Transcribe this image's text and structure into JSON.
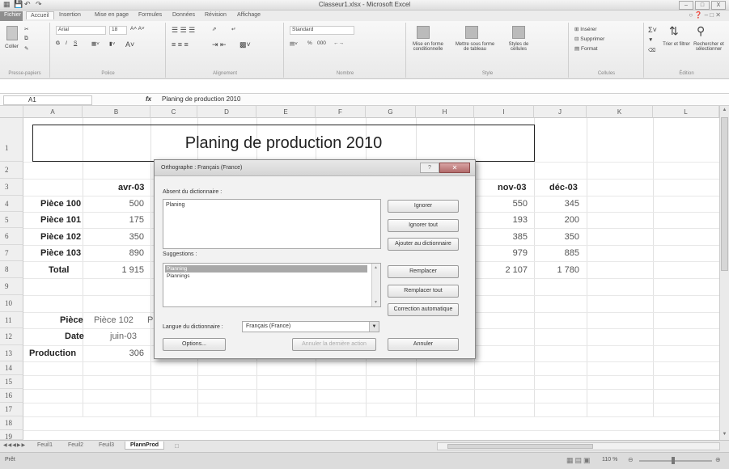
{
  "app": {
    "window_title": "Classeur1.xlsx - Microsoft Excel"
  },
  "window_controls": [
    "–",
    "□",
    "X"
  ],
  "ribbon_tabs": [
    "Fichier",
    "Accueil",
    "Insertion",
    "Mise en page",
    "Formules",
    "Données",
    "Révision",
    "Affichage"
  ],
  "ribbon": {
    "clipboard": {
      "label": "Presse-papiers",
      "paste": "Coller"
    },
    "font": {
      "label": "Police",
      "font_name": "Arial",
      "font_size": "18",
      "bold": "G",
      "italic": "I",
      "underline": "S"
    },
    "alignment": {
      "label": "Alignement"
    },
    "number": {
      "label": "Nombre",
      "format": "Standard",
      "percent": "%",
      "thousands": "000"
    },
    "styles": {
      "label": "Style",
      "cond": "Mise en forme conditionnelle",
      "table": "Mettre sous forme de tableau",
      "cell": "Styles de cellules"
    },
    "cells": {
      "label": "Cellules",
      "insert": "Insérer",
      "delete": "Supprimer",
      "format": "Format"
    },
    "editing": {
      "label": "Édition",
      "sort": "Trier et filtrer",
      "find": "Rechercher et sélectionner"
    }
  },
  "formula_bar": {
    "name_box": "A1",
    "fx": "fx",
    "content": "Planing de production 2010"
  },
  "columns": [
    "A",
    "B",
    "C",
    "D",
    "E",
    "F",
    "G",
    "H",
    "I",
    "J",
    "K",
    "L"
  ],
  "rows": [
    "1",
    "2",
    "3",
    "4",
    "5",
    "6",
    "7",
    "8",
    "9",
    "10",
    "11",
    "12",
    "13",
    "14",
    "15",
    "16",
    "17",
    "18",
    "19"
  ],
  "sheet": {
    "title": "Planing de production 2010",
    "header_b": "avr-03",
    "header_i": "nov-03",
    "header_j": "déc-03",
    "items": [
      {
        "label": "Pièce 100",
        "b": "500",
        "i": "550",
        "j": "345"
      },
      {
        "label": "Pièce 101",
        "b": "175",
        "i": "193",
        "j": "200"
      },
      {
        "label": "Pièce 102",
        "b": "350",
        "i": "385",
        "j": "350"
      },
      {
        "label": "Pièce 103",
        "b": "890",
        "i": "979",
        "j": "885"
      }
    ],
    "total": {
      "label": "Total",
      "b": "1 915",
      "i": "2 107",
      "j": "1 780"
    },
    "lookup": {
      "piece_label": "Pièce",
      "piece_value": "Pièce 102",
      "piece_extra": "P",
      "date_label": "Date",
      "date_value": "juin-03",
      "prod_label": "Production",
      "prod_value": "306"
    }
  },
  "dialog": {
    "title": "Orthographe : Français (France)",
    "absent_label": "Absent du dictionnaire :",
    "absent_word": "Planing",
    "suggestions_label": "Suggestions :",
    "suggestions": [
      "Planning",
      "Plannings"
    ],
    "language_label": "Langue du dictionnaire :",
    "language_value": "Français (France)",
    "buttons": {
      "ignore": "Ignorer",
      "ignore_all": "Ignorer tout",
      "add": "Ajouter au dictionnaire",
      "replace": "Remplacer",
      "replace_all": "Remplacer tout",
      "autocorrect": "Correction automatique",
      "options": "Options...",
      "undo": "Annuler la dernière action",
      "cancel": "Annuler"
    }
  },
  "sheet_tabs": [
    "Feuil1",
    "Feuil2",
    "Feuil3",
    "PlannProd"
  ],
  "status": {
    "mode": "Prêt",
    "zoom": "110 %"
  }
}
